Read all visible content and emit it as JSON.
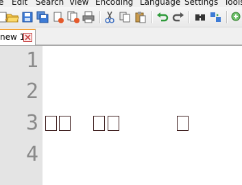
{
  "menu": {
    "items": [
      "e",
      "Edit",
      "Search",
      "View",
      "Encoding",
      "Language",
      "Settings",
      "Tools"
    ]
  },
  "toolbar": {
    "buttons": [
      "new-file-icon",
      "open-file-icon",
      "save-icon",
      "save-all-icon",
      "close-icon",
      "close-all-icon",
      "print-icon",
      "cut-icon",
      "copy-icon",
      "paste-icon",
      "undo-icon",
      "redo-icon",
      "find-icon",
      "replace-icon",
      "zoom-in-icon"
    ]
  },
  "tabs": [
    {
      "label": "new 1",
      "close_icon": "close-tab-icon"
    }
  ],
  "editor": {
    "line_numbers": [
      "1",
      "2",
      "3",
      "4"
    ],
    "line3_glyphs": [
      "□",
      "□",
      "□",
      "□",
      "□"
    ]
  },
  "colors": {
    "tab_accent": "#f3a33a",
    "gutter": "#e4e4e4",
    "line_number": "#8a8a8a",
    "glyph_border": "#3b1b1b"
  }
}
